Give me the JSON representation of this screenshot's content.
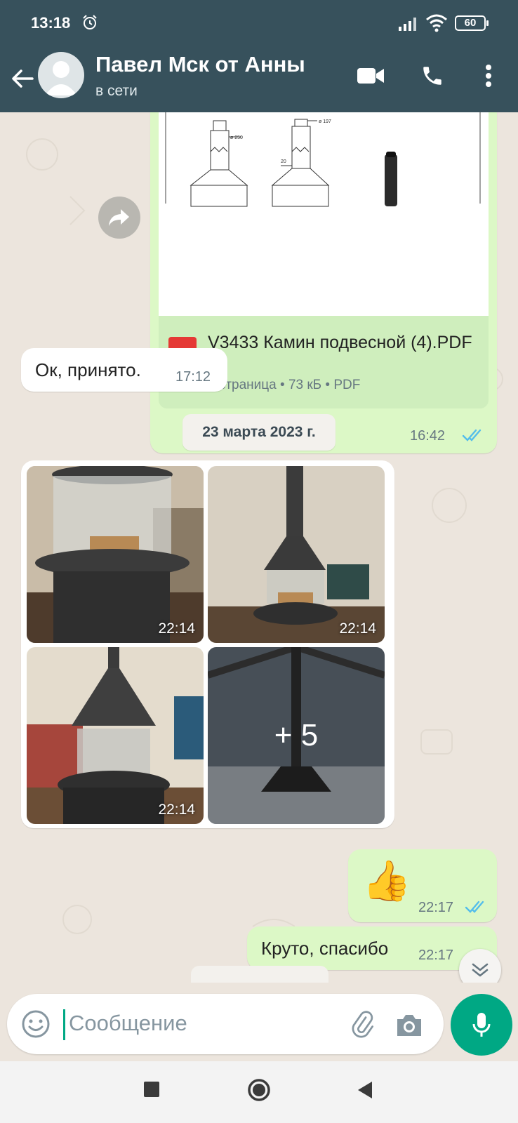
{
  "status_bar": {
    "time": "13:18",
    "battery": "60",
    "icons": [
      "alarm-icon",
      "signal-icon",
      "wifi-icon",
      "battery-icon"
    ]
  },
  "header": {
    "contact_name": "Павел Мск от Анны",
    "contact_status": "в сети",
    "icons": [
      "back-arrow-icon",
      "video-call-icon",
      "phone-icon",
      "more-vert-icon"
    ]
  },
  "messages": {
    "pdf": {
      "file_name": "V3433 Камин подвесной (4).PDF",
      "meta": "1 страница • 73 кБ • PDF",
      "badge": "PDF",
      "time": "16:42",
      "drawing_labels": [
        "ø 250",
        "ø 197",
        "20"
      ]
    },
    "incoming_ok": {
      "text": "Ок, принято.",
      "time": "17:12"
    },
    "date_separator": "23 марта 2023 г.",
    "gallery": {
      "photos": [
        {
          "time": "22:14"
        },
        {
          "time": "22:14"
        },
        {
          "time": "22:14"
        }
      ],
      "more_count": "+ 5"
    },
    "thumbs_up": {
      "emoji": "👍",
      "time": "22:17"
    },
    "thanks": {
      "text": "Круто, спасибо",
      "time": "22:17"
    }
  },
  "input": {
    "placeholder": "Сообщение"
  },
  "colors": {
    "header_bg": "#37515c",
    "outgoing_bubble": "#dcf8c6",
    "incoming_bubble": "#ffffff",
    "accent": "#00a884",
    "read_ticks": "#53bdeb"
  }
}
